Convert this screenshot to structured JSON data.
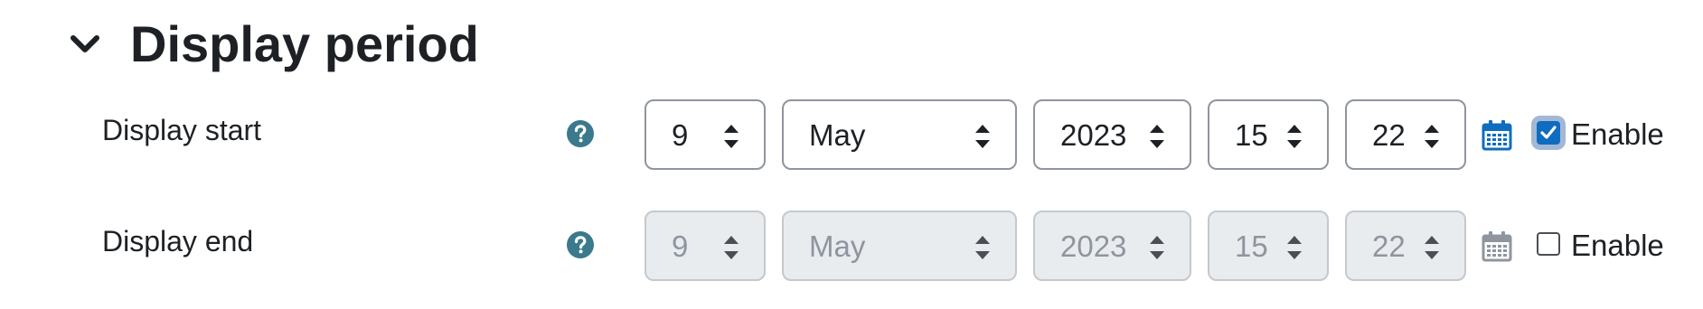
{
  "section": {
    "title": "Display period",
    "collapse_icon": "chevron-down-icon"
  },
  "colors": {
    "brand_blue": "#0f6cbf",
    "help_teal": "#3a7a8c",
    "disabled_bg": "#e9ecef",
    "text": "#1d2125"
  },
  "display_start": {
    "label": "Display start",
    "help_icon": "question-circle-icon",
    "day": "9",
    "month": "May",
    "year": "2023",
    "hour": "15",
    "minute": "22",
    "calendar_icon": "calendar-icon",
    "enable_label": "Enable",
    "enabled": true
  },
  "display_end": {
    "label": "Display end",
    "help_icon": "question-circle-icon",
    "day": "9",
    "month": "May",
    "year": "2023",
    "hour": "15",
    "minute": "22",
    "calendar_icon": "calendar-icon",
    "enable_label": "Enable",
    "enabled": false
  }
}
